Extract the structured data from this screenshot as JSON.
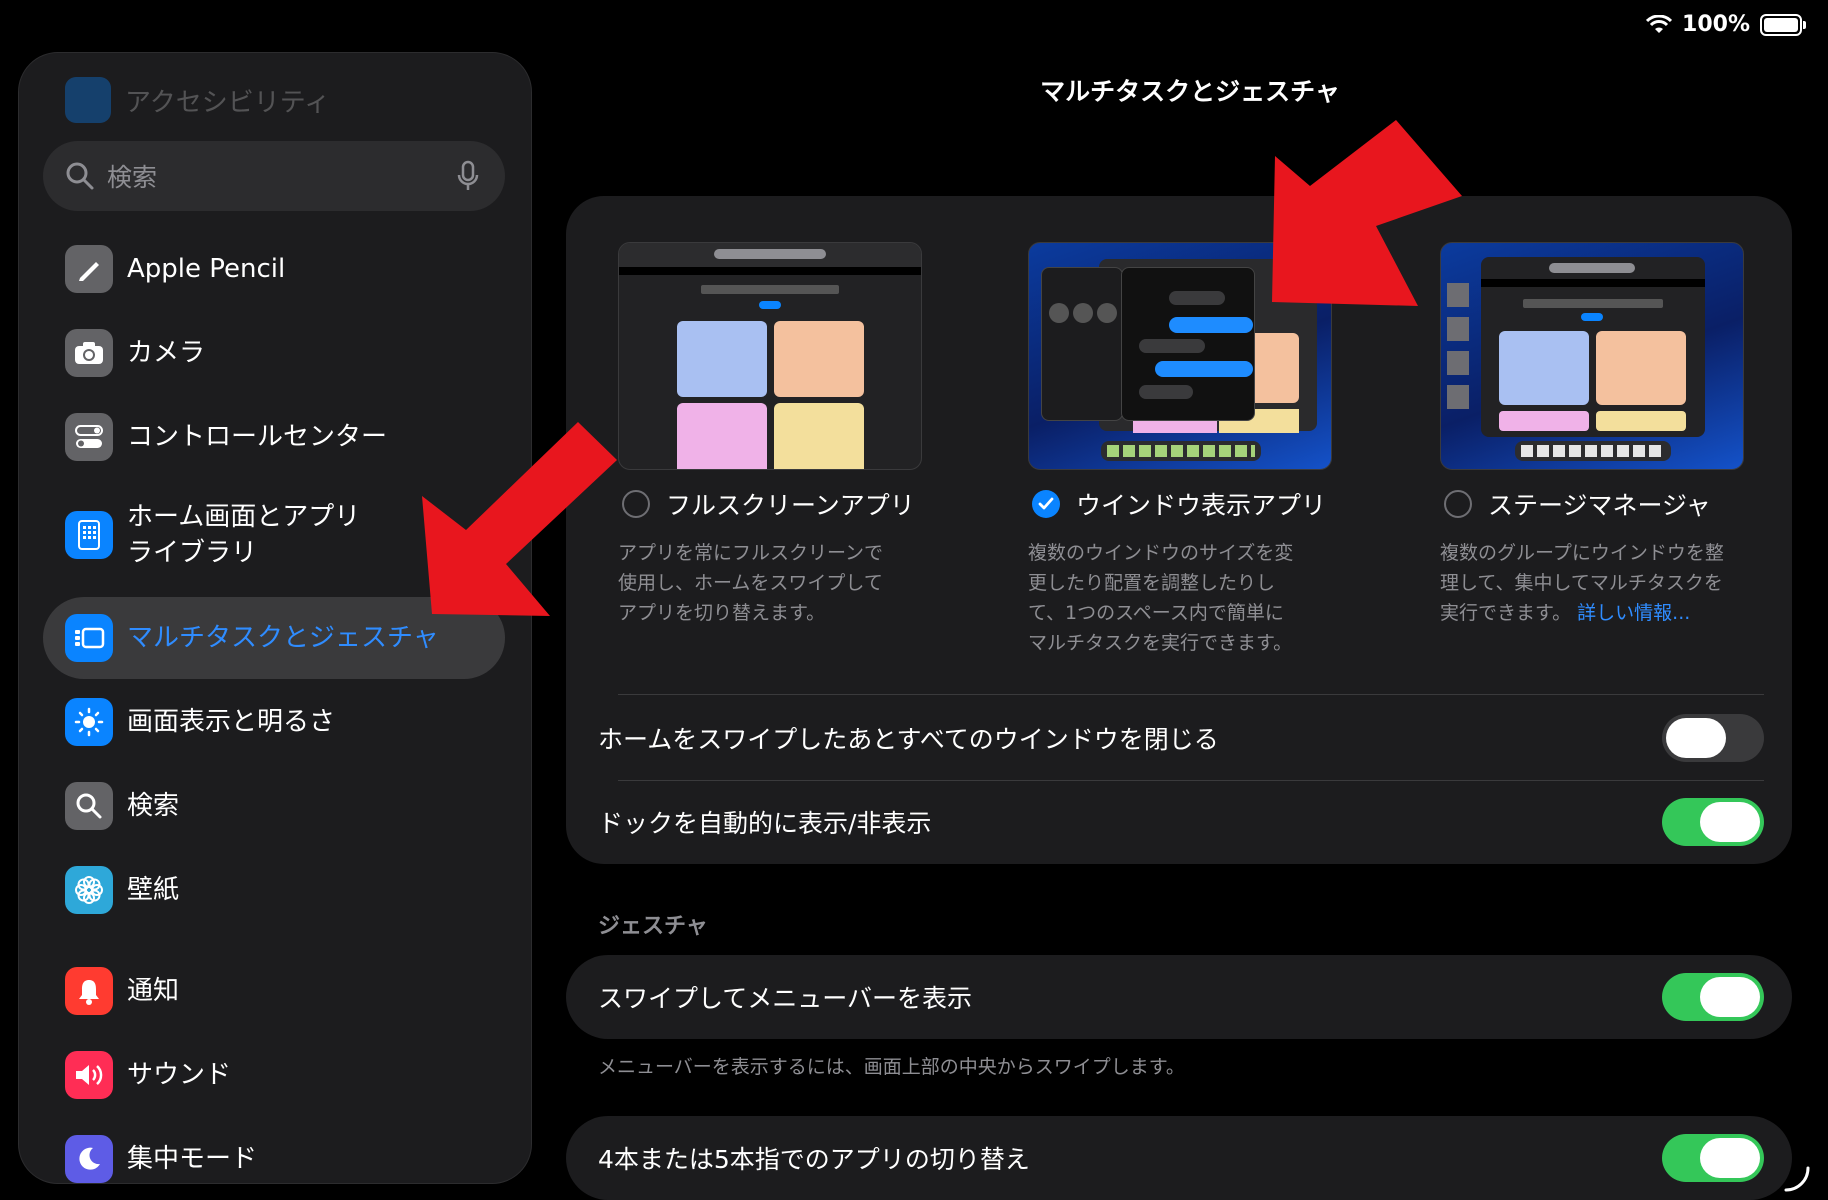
{
  "status": {
    "battery": "100%"
  },
  "sidebar": {
    "top_item": "アクセシビリティ",
    "search_placeholder": "検索",
    "items": [
      {
        "label": "Apple Pencil"
      },
      {
        "label": "カメラ"
      },
      {
        "label": "コントロールセンター"
      },
      {
        "label": "ホーム画面とアプリ",
        "label2": "ライブラリ"
      },
      {
        "label": "マルチタスクとジェスチャ"
      },
      {
        "label": "画面表示と明るさ"
      },
      {
        "label": "検索"
      },
      {
        "label": "壁紙"
      },
      {
        "label": "通知"
      },
      {
        "label": "サウンド"
      },
      {
        "label": "集中モード"
      }
    ]
  },
  "main": {
    "title": "マルチタスクとジェスチャ",
    "options": [
      {
        "label": "フルスクリーンアプリ",
        "selected": false,
        "desc": [
          "アプリを常にフルスクリーンで",
          "使用し、ホームをスワイプして",
          "アプリを切り替えます。"
        ]
      },
      {
        "label": "ウインドウ表示アプリ",
        "selected": true,
        "desc": [
          "複数のウインドウのサイズを変",
          "更したり配置を調整したりし",
          "て、1つのスペース内で簡単に",
          "マルチタスクを実行できます。"
        ]
      },
      {
        "label": "ステージマネージャ",
        "selected": false,
        "desc": [
          "複数のグループにウインドウを整",
          "理して、集中してマルチタスクを",
          "実行できます。"
        ],
        "link": "詳しい情報..."
      }
    ],
    "rows": [
      {
        "label": "ホームをスワイプしたあとすべてのウインドウを閉じる",
        "on": false
      },
      {
        "label": "ドックを自動的に表示/非表示",
        "on": true
      }
    ],
    "gesture_header": "ジェスチャ",
    "gesture_rows": [
      {
        "label": "スワイプしてメニューバーを表示",
        "on": true,
        "footer": "メニューバーを表示するには、画面上部の中央からスワイプします。"
      },
      {
        "label": "4本または5本指でのアプリの切り替え",
        "on": true
      }
    ]
  },
  "colors": {
    "accent": "#0a84ff",
    "toggle_on": "#34c759",
    "annotation_arrow": "#e8161e"
  }
}
